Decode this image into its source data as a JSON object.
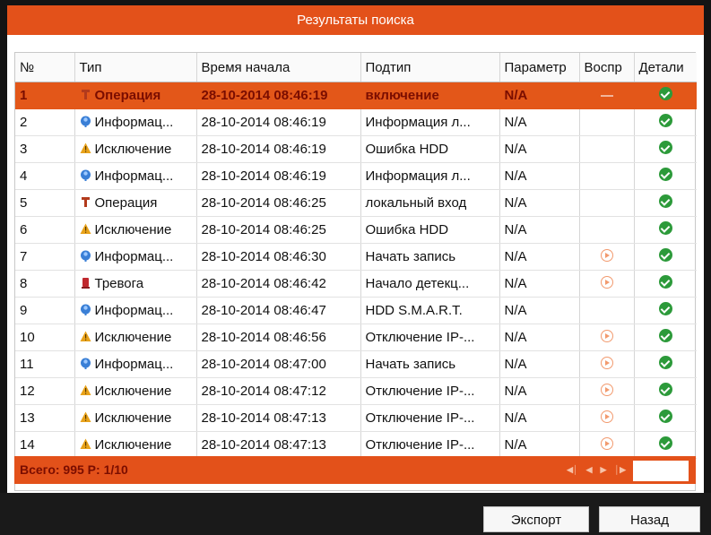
{
  "window": {
    "title": "Результаты поиска"
  },
  "table": {
    "columns": [
      "№",
      "Тип",
      "Время начала",
      "Подтип",
      "Параметр",
      "Воспр",
      "Детали"
    ],
    "rows": [
      {
        "no": "1",
        "type": "Операция",
        "type_icon": "wrench-icon",
        "time": "28-10-2014 08:46:19",
        "subtype": "включение",
        "param": "N/A",
        "play": "dash",
        "selected": true
      },
      {
        "no": "2",
        "type": "Информац...",
        "type_icon": "info-icon",
        "time": "28-10-2014 08:46:19",
        "subtype": "Информация л...",
        "param": "N/A",
        "play": "none",
        "selected": false
      },
      {
        "no": "3",
        "type": "Исключение",
        "type_icon": "warning-icon",
        "time": "28-10-2014 08:46:19",
        "subtype": "Ошибка HDD",
        "param": "N/A",
        "play": "none",
        "selected": false
      },
      {
        "no": "4",
        "type": "Информац...",
        "type_icon": "info-icon",
        "time": "28-10-2014 08:46:19",
        "subtype": "Информация л...",
        "param": "N/A",
        "play": "none",
        "selected": false
      },
      {
        "no": "5",
        "type": "Операция",
        "type_icon": "wrench-icon",
        "time": "28-10-2014 08:46:25",
        "subtype": "локальный вход",
        "param": "N/A",
        "play": "none",
        "selected": false
      },
      {
        "no": "6",
        "type": "Исключение",
        "type_icon": "warning-icon",
        "time": "28-10-2014 08:46:25",
        "subtype": "Ошибка HDD",
        "param": "N/A",
        "play": "none",
        "selected": false
      },
      {
        "no": "7",
        "type": "Информац...",
        "type_icon": "info-icon",
        "time": "28-10-2014 08:46:30",
        "subtype": "Начать запись",
        "param": "N/A",
        "play": "play",
        "selected": false
      },
      {
        "no": "8",
        "type": "Тревога",
        "type_icon": "alarm-icon",
        "time": "28-10-2014 08:46:42",
        "subtype": "Начало детекц...",
        "param": "N/A",
        "play": "play",
        "selected": false
      },
      {
        "no": "9",
        "type": "Информац...",
        "type_icon": "info-icon",
        "time": "28-10-2014 08:46:47",
        "subtype": "HDD S.M.A.R.T.",
        "param": "N/A",
        "play": "none",
        "selected": false
      },
      {
        "no": "10",
        "type": "Исключение",
        "type_icon": "warning-icon",
        "time": "28-10-2014 08:46:56",
        "subtype": "Отключение IP-...",
        "param": "N/A",
        "play": "play",
        "selected": false
      },
      {
        "no": "11",
        "type": "Информац...",
        "type_icon": "info-icon",
        "time": "28-10-2014 08:47:00",
        "subtype": "Начать запись",
        "param": "N/A",
        "play": "play",
        "selected": false
      },
      {
        "no": "12",
        "type": "Исключение",
        "type_icon": "warning-icon",
        "time": "28-10-2014 08:47:12",
        "subtype": "Отключение IP-...",
        "param": "N/A",
        "play": "play",
        "selected": false
      },
      {
        "no": "13",
        "type": "Исключение",
        "type_icon": "warning-icon",
        "time": "28-10-2014 08:47:13",
        "subtype": "Отключение IP-...",
        "param": "N/A",
        "play": "play",
        "selected": false
      },
      {
        "no": "14",
        "type": "Исключение",
        "type_icon": "warning-icon",
        "time": "28-10-2014 08:47:13",
        "subtype": "Отключение IP-...",
        "param": "N/A",
        "play": "play",
        "selected": false
      }
    ]
  },
  "footer": {
    "summary": "Всего: 995  P: 1/10",
    "page_input": ""
  },
  "buttons": {
    "export": "Экспорт",
    "back": "Назад"
  },
  "colors": {
    "accent": "#e3511a",
    "selected_text": "#7a0d00",
    "details_green": "#2c9a3a"
  }
}
